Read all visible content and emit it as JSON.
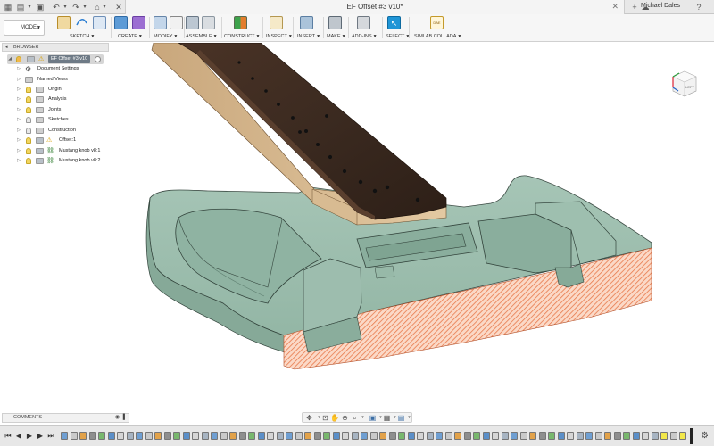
{
  "window": {
    "document_title": "EF Offset #3 v10*",
    "user_name": "Michael Dales"
  },
  "toolbar": {
    "workspace": "MODEL",
    "groups": [
      {
        "label": "SKETCH"
      },
      {
        "label": "CREATE"
      },
      {
        "label": "MODIFY"
      },
      {
        "label": "ASSEMBLE"
      },
      {
        "label": "CONSTRUCT"
      },
      {
        "label": "INSPECT"
      },
      {
        "label": "INSERT"
      },
      {
        "label": "MAKE"
      },
      {
        "label": "ADD-INS"
      },
      {
        "label": "SELECT"
      },
      {
        "label": "SIMLAB COLLADA"
      }
    ],
    "simlab_icon_text": "DAE"
  },
  "browser": {
    "title": "BROWSER",
    "root": "EF Offset #3 v10",
    "items": [
      {
        "label": "Document Settings"
      },
      {
        "label": "Named Views"
      },
      {
        "label": "Origin"
      },
      {
        "label": "Analysis"
      },
      {
        "label": "Joints"
      },
      {
        "label": "Sketches"
      },
      {
        "label": "Construction"
      },
      {
        "label": "Offset:1"
      },
      {
        "label": "Mustang knob v8:1"
      },
      {
        "label": "Mustang knob v8:2"
      }
    ]
  },
  "viewcube": {
    "face": "LEFT"
  },
  "comments": {
    "title": "COMMENTS"
  },
  "colors": {
    "body": "#9cbcae",
    "section_hatch": "#f3a07c",
    "neck_wood": "#a98a62",
    "fretboard": "#3a2a20",
    "select_blue": "#1f95d6"
  }
}
